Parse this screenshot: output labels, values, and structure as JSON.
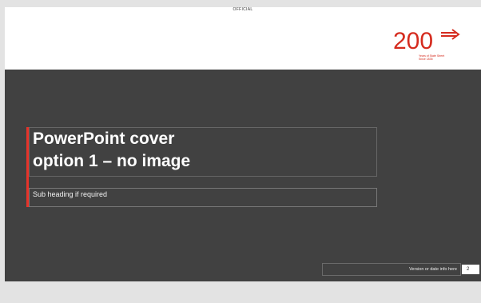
{
  "header": {
    "classification": "OFFICIAL"
  },
  "logo": {
    "number": "200",
    "subtitle": [
      "Years of State Street",
      "Since 1835"
    ]
  },
  "slide": {
    "title_line1": "PowerPoint cover",
    "title_line2": "option 1 – no image",
    "subtitle": "Sub heading if required",
    "version_text": "Version or date info here",
    "page_number": "2"
  },
  "colors": {
    "dark_background": "#414141",
    "accent_red": "#e6332a",
    "page_background": "#e3e3e3"
  }
}
